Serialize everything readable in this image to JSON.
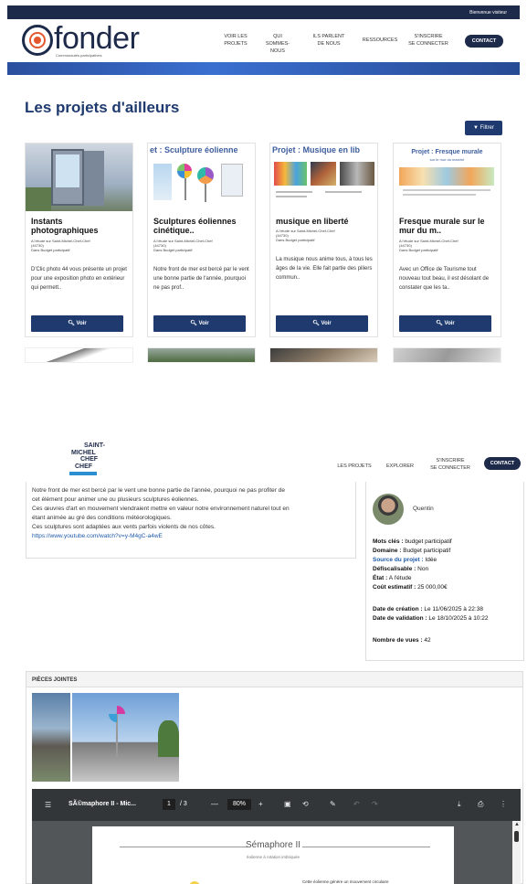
{
  "top": {
    "welcome": "Bienvenue visiteur",
    "logo_word": "fonder",
    "logo_tagline": "Communautés participatives",
    "nav": [
      {
        "l1": "VOIR LES",
        "l2": "PROJETS"
      },
      {
        "l1": "QUI",
        "l2": "SOMMES-NOUS"
      },
      {
        "l1": "ILS PARLENT",
        "l2": "DE NOUS"
      },
      {
        "l1": "RESSOURCES",
        "l2": ""
      },
      {
        "l1": "S'INSCRIRE",
        "l2": "SE CONNECTER"
      }
    ],
    "contact": "CONTACT",
    "page_title": "Les projets d'ailleurs",
    "filter_label": "Filtrer",
    "voir_label": "Voir",
    "cards": [
      {
        "image_title": "",
        "title": "Instants photographiques",
        "meta1": "A l'étude sur Saint-Michel-Chef-Chef",
        "meta2": "(44730)",
        "meta3": "Dans Budget participatif",
        "desc": "D'Clic photo 44 vous présente un projet pour une exposition photo en extérieur qui permett.."
      },
      {
        "image_title": "et : Sculpture éolienne",
        "title": "Sculptures éoliennes cinétique..",
        "meta1": "A l'étude sur Saint-Michel-Chef-Chef",
        "meta2": "(44730)",
        "meta3": "Dans Budget participatif",
        "desc": "Notre front de mer est bercé par le vent une bonne partie de l'année, pourquoi ne pas prof.."
      },
      {
        "image_title": "Projet : Musique en lib",
        "title": "musique en liberté",
        "meta1": "A l'étude sur Saint-Michel-Chef-Chef",
        "meta2": "(44730)",
        "meta3": "Dans Budget participatif",
        "desc": "La musique nous anime tous, à tous les âges de la vie. Elle fait partie des piliers commun.."
      },
      {
        "image_title": "Projet : Fresque murale",
        "image_subtitle": "sur le mur du marché",
        "title": "Fresque murale sur le mur du m..",
        "meta1": "A l'étude sur Saint-Michel-Chef-Chef",
        "meta2": "(44730)",
        "meta3": "Dans Budget participatif",
        "desc": "Avec un Office de Tourisme tout nouveau tout beau, il est désolant de constater que les ta.."
      }
    ]
  },
  "detail": {
    "logo_text": [
      "SAINT-",
      "MICHEL",
      "CHEF",
      "CHEF"
    ],
    "nav": [
      {
        "l1": "LES PROJETS",
        "l2": ""
      },
      {
        "l1": "EXPLORER",
        "l2": ""
      },
      {
        "l1": "S'INSCRIRE",
        "l2": "SE CONNECTER"
      }
    ],
    "contact": "CONTACT",
    "desc_lines": [
      "Notre front de mer est bercé par le vent une bonne partie de l'année, pourquoi ne pas profiter de",
      "cet élément pour animer une ou plusieurs sculptures éoliennes.",
      "Ces œuvres d'art en mouvement viendraient mettre en valeur notre environnement naturel tout en",
      "étant animée au gré des conditions météorologiques.",
      "Ces sculptures sont adaptées aux vents parfois violents de nos côtes."
    ],
    "desc_link": "https://www.youtube.com/watch?v=y-M4gC-a4wE",
    "author": "Quentin",
    "info": {
      "mots_cles_label": "Mots clés :",
      "mots_cles": "budget participatif",
      "domaine_label": "Domaine :",
      "domaine": "Budget participatif",
      "source_label": "Source du projet :",
      "source": "Idée",
      "defisc_label": "Défiscalisable :",
      "defisc": "Non",
      "etat_label": "État :",
      "etat": "A l'étude",
      "cout_label": "Coût estimatif :",
      "cout": "25 000,00€",
      "creation_label": "Date de création :",
      "creation": "Le 11/06/2025 à 22:38",
      "validation_label": "Date de validation :",
      "validation": "Le 18/10/2025 à 10:22",
      "vues_label": "Nombre de vues :",
      "vues": "42"
    },
    "attachments_label": "PIÈCES JOINTES",
    "pdf": {
      "filename": "SÃ©maphore II - Mic...",
      "page": "1",
      "pages": "/ 3",
      "zoom": "80%",
      "doc_title": "Sémaphore II",
      "doc_subtitle": "éolienne à rotation imbriquée",
      "doc_text": "Cette éolienne génère un mouvement circulaire"
    }
  }
}
